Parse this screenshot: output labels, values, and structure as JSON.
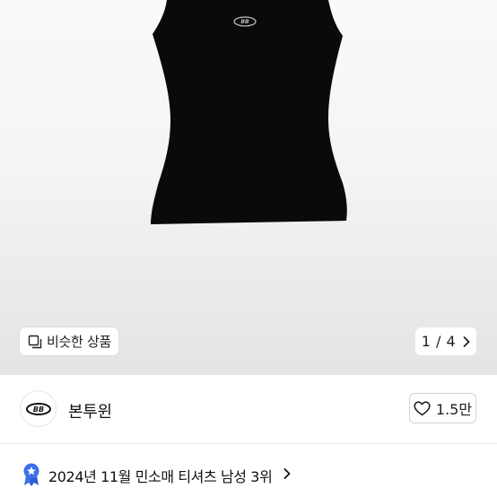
{
  "product": {
    "image_pager": {
      "current": "1",
      "total": "4",
      "label": "1 / 4"
    },
    "similar_products_label": "비슷한 상품"
  },
  "shop": {
    "name": "본투윈",
    "likes": "1.5만",
    "like_icon": "heart-outline-icon"
  },
  "ranking": {
    "text": "2024년 11월 민소매 티셔츠 남성 3위",
    "badge_color": "#3d6fe8"
  },
  "colors": {
    "garment": "#0a0a0a",
    "accent": "#3d6fe8"
  }
}
